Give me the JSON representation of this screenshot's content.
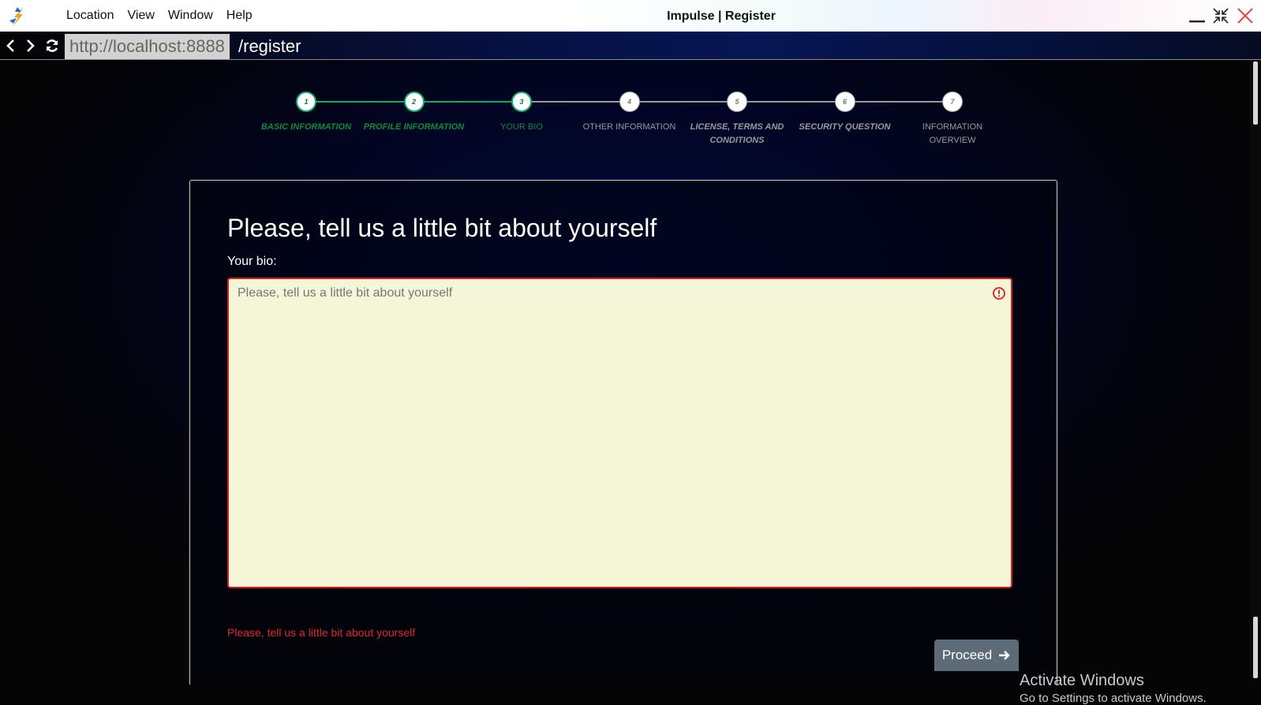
{
  "titlebar": {
    "menu": [
      "Location",
      "View",
      "Window",
      "Help"
    ],
    "title": "Impulse | Register"
  },
  "address": {
    "host": "http://localhost:8888",
    "path": "/register"
  },
  "steps": [
    {
      "number": "1",
      "label": "BASIC INFORMATION",
      "state": "completed",
      "italic": true
    },
    {
      "number": "2",
      "label": "PROFILE INFORMATION",
      "state": "completed",
      "italic": true
    },
    {
      "number": "3",
      "label": "YOUR BIO",
      "state": "current",
      "italic": false
    },
    {
      "number": "4",
      "label": "OTHER INFORMATION",
      "state": "pending",
      "italic": false
    },
    {
      "number": "5",
      "label": "LICENSE, TERMS AND CONDITIONS",
      "state": "pending",
      "italic": true
    },
    {
      "number": "6",
      "label": "SECURITY QUESTION",
      "state": "pending",
      "italic": true
    },
    {
      "number": "7",
      "label": "INFORMATION OVERVIEW",
      "state": "pending",
      "italic": false
    }
  ],
  "colors": {
    "step_done": "#11a86a",
    "step_label_done": "#0d8a3e",
    "step_pending": "#9a9a9a",
    "error": "#d81b24",
    "textarea_bg": "#f5f5d8",
    "proceed_bg": "#5c6b77"
  },
  "form": {
    "title": "Please, tell us a little bit about yourself",
    "bio_label": "Your bio:",
    "bio_placeholder": "Please, tell us a little bit about yourself",
    "bio_value": "",
    "error_message": "Please, tell us a little bit about yourself",
    "proceed_label": "Proceed",
    "proceed_icon": "arrow-right-icon"
  },
  "watermark": {
    "title": "Activate Windows",
    "subtitle": "Go to Settings to activate Windows."
  }
}
